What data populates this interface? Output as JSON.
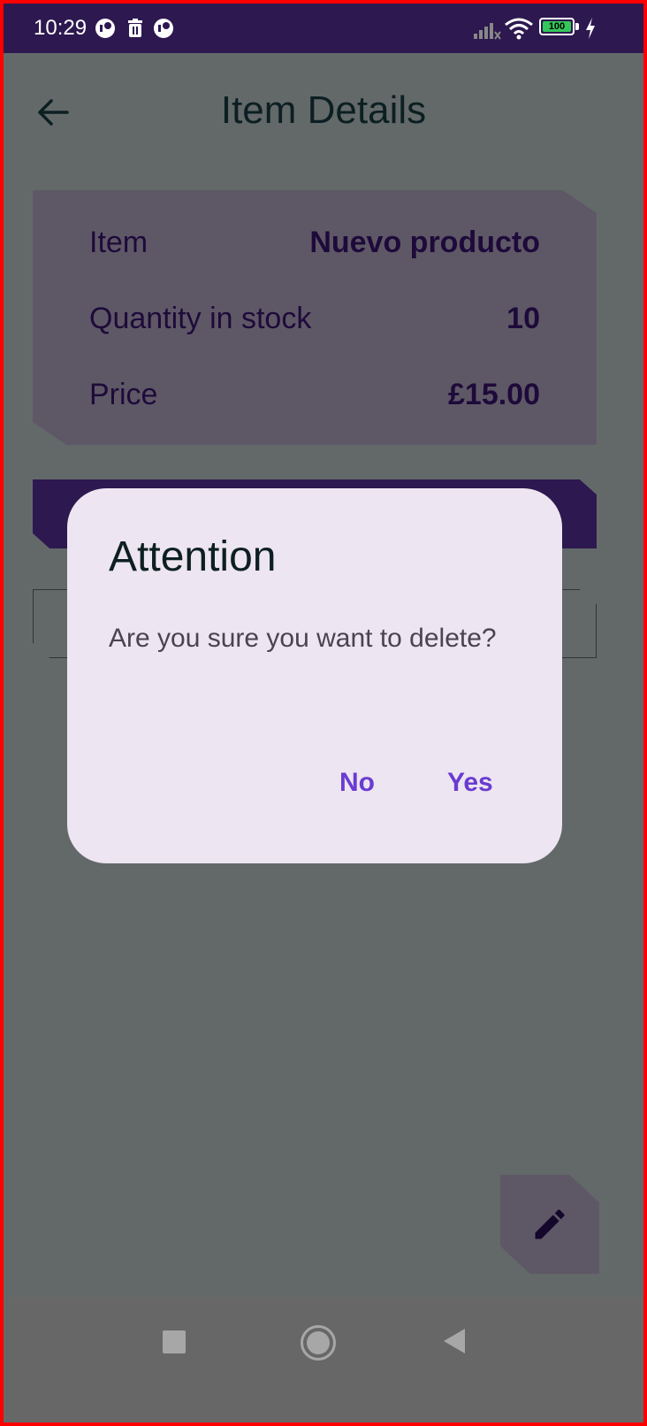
{
  "status_bar": {
    "time": "10:29",
    "battery_level": "100",
    "icons": [
      "app-notification-icon",
      "trash-notification-icon",
      "app-notification-icon",
      "signal-icon",
      "wifi-icon",
      "battery-icon",
      "charging-icon"
    ]
  },
  "app_bar": {
    "title": "Item Details",
    "back_icon": "arrow-back-icon"
  },
  "details": {
    "rows": [
      {
        "label": "Item",
        "value": "Nuevo producto"
      },
      {
        "label": "Quantity in stock",
        "value": "10"
      },
      {
        "label": "Price",
        "value": "£15.00"
      }
    ]
  },
  "dialog": {
    "title": "Attention",
    "message": "Are you sure you want to delete?",
    "no_label": "No",
    "yes_label": "Yes"
  },
  "fab": {
    "icon": "edit-pencil-icon"
  },
  "nav_bar": {
    "icons": [
      "recent-apps-icon",
      "home-icon",
      "back-icon"
    ]
  },
  "colors": {
    "status_bar": "#2d1850",
    "scrim_background": "#636969",
    "card": "#5e5866",
    "dialog": "#ede5f1",
    "dialog_button_text": "#6a3cd0"
  }
}
